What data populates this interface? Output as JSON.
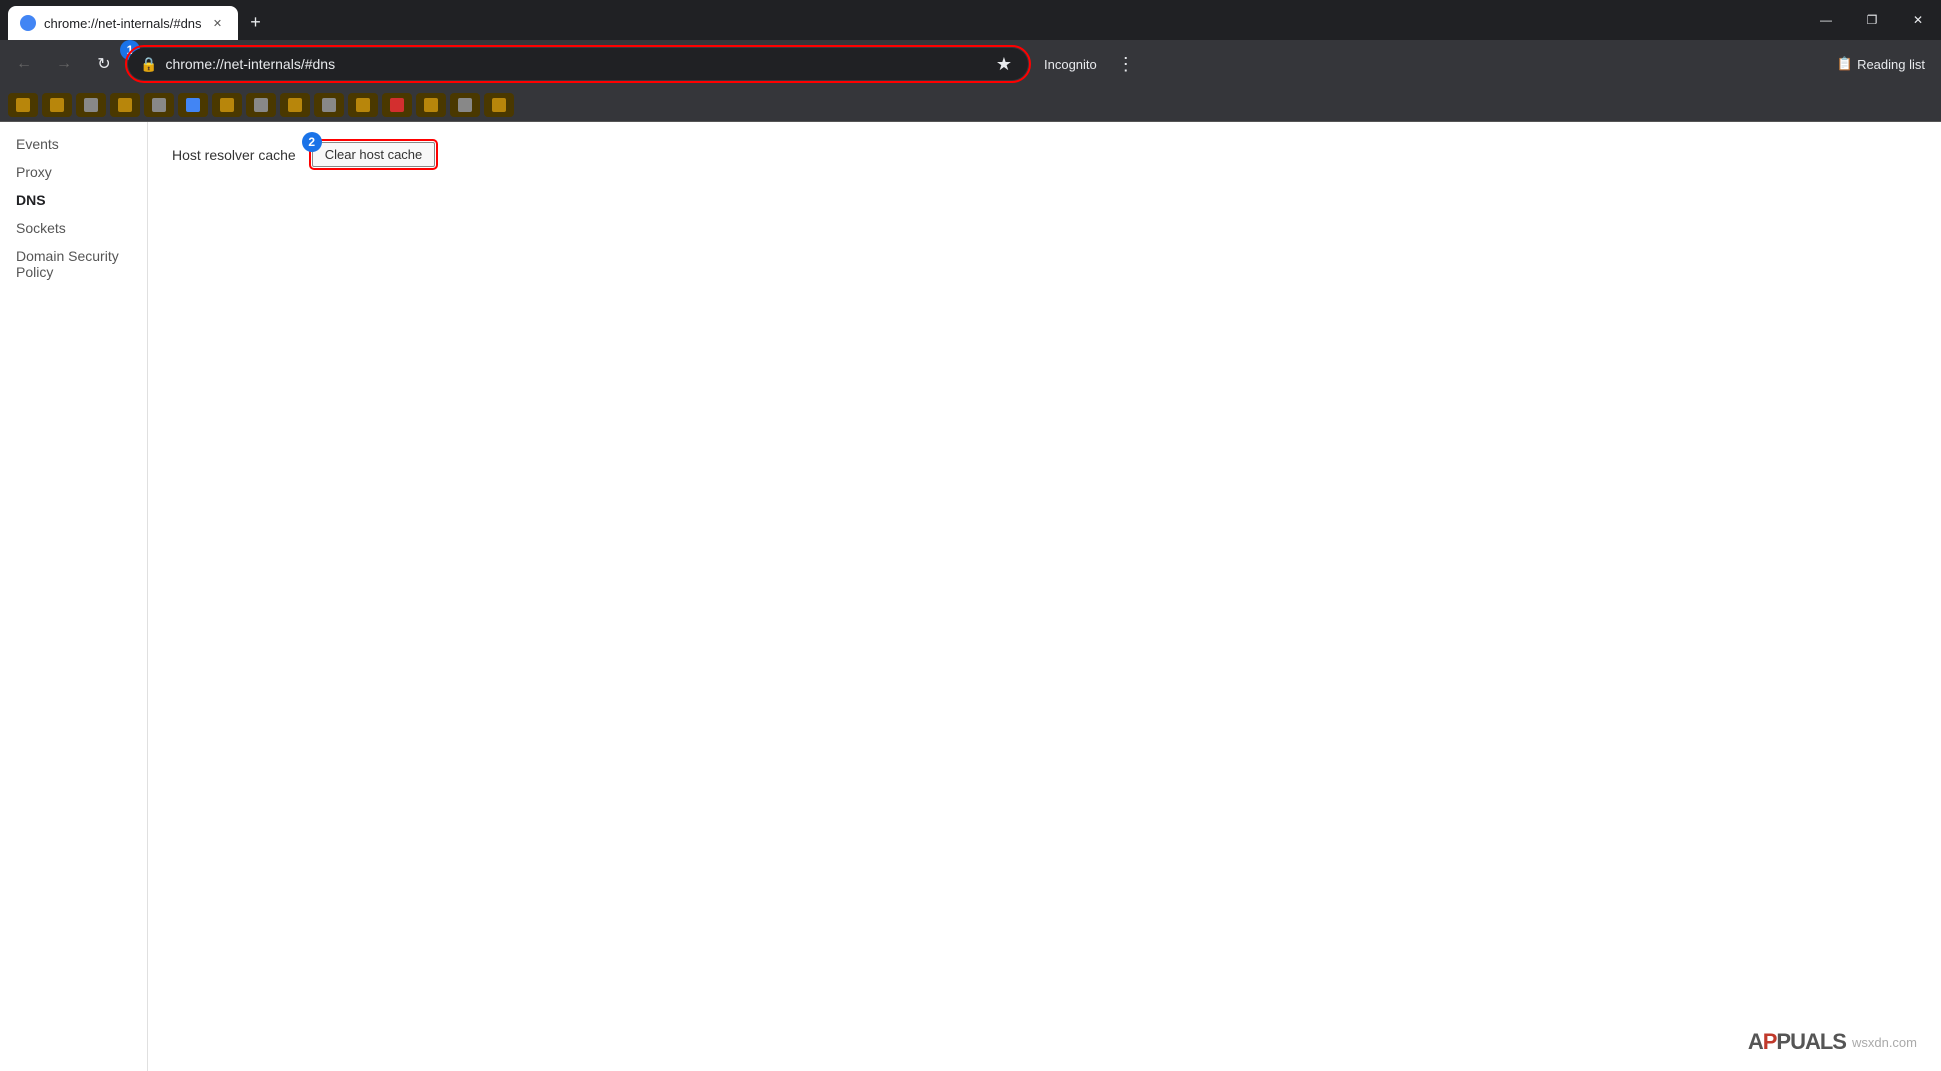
{
  "browser": {
    "tab": {
      "favicon_alt": "chrome-icon",
      "title": "chrome://net-internals/#dns"
    },
    "new_tab_label": "+",
    "window_controls": {
      "minimize": "—",
      "restore": "❐",
      "close": "✕"
    },
    "toolbar": {
      "back_btn": "←",
      "forward_btn": "→",
      "refresh_btn": "↻",
      "address": "chrome://net-internals/#dns",
      "star_icon": "★",
      "incognito_label": "Incognito",
      "menu_icon": "⋮",
      "reading_list_label": "Reading list"
    },
    "badge1_label": "1",
    "badge2_label": "2"
  },
  "sidebar": {
    "items": [
      {
        "id": "events",
        "label": "Events",
        "active": false
      },
      {
        "id": "proxy",
        "label": "Proxy",
        "active": false
      },
      {
        "id": "dns",
        "label": "DNS",
        "active": true
      },
      {
        "id": "sockets",
        "label": "Sockets",
        "active": false
      },
      {
        "id": "domain-security-policy",
        "label": "Domain Security Policy",
        "active": false
      }
    ]
  },
  "main": {
    "host_resolver_label": "Host resolver cache",
    "clear_cache_btn_label": "Clear host cache"
  },
  "watermark": {
    "site": "wsxdn.com"
  }
}
